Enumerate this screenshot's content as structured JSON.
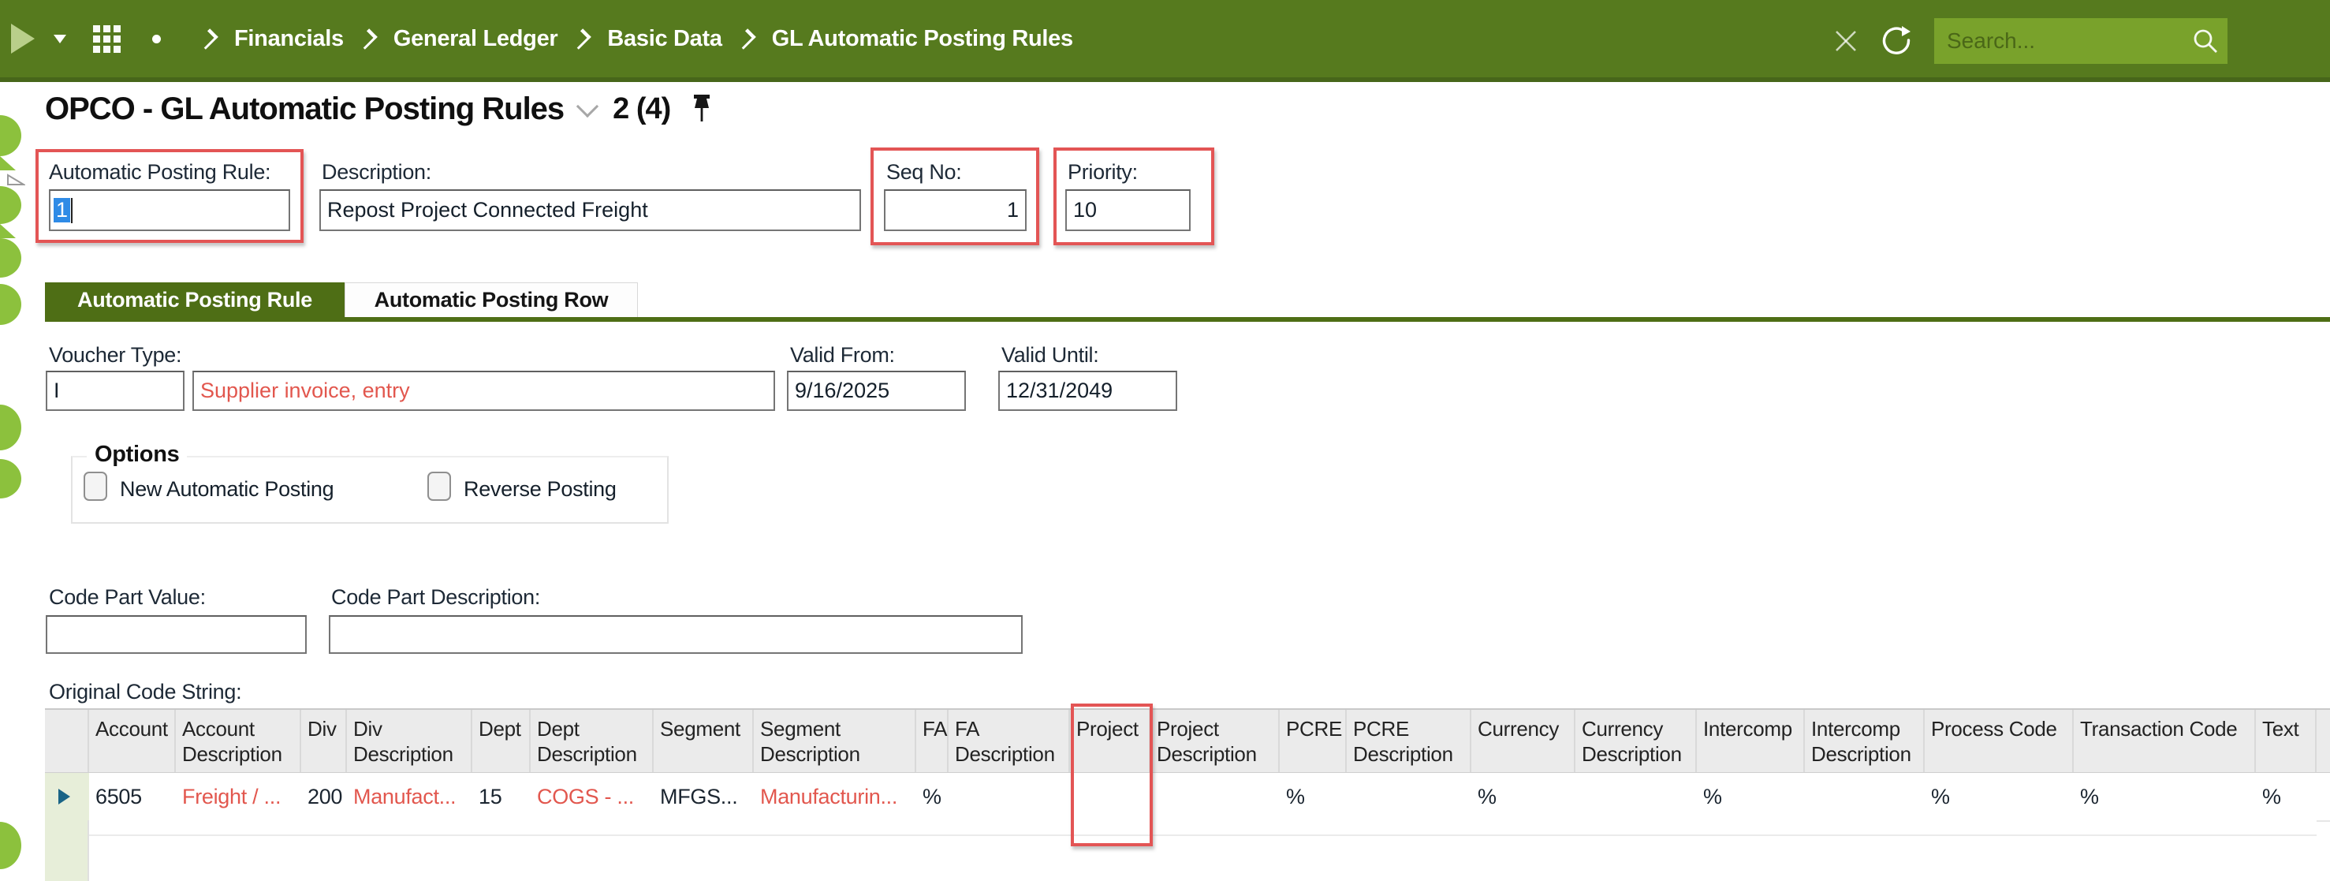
{
  "colors": {
    "topbar_green": "#567a1e",
    "accent_green": "#4e6e15",
    "search_green": "#79a22b",
    "lime_circle": "#8cc13d",
    "annotation_red": "#e35555",
    "field_red_text": "#e2574e",
    "selection_blue": "#2f8be6",
    "row_selector_green": "#e7eed9",
    "row_marker_blue": "#1a6486"
  },
  "topbar": {
    "breadcrumbs": [
      "Financials",
      "General Ledger",
      "Basic Data",
      "GL Automatic Posting Rules"
    ],
    "search": {
      "placeholder": "Search..."
    },
    "icons": {
      "play": "triangle-right",
      "caret": "triangle-down",
      "waffle": "app-grid",
      "dot": "bullet",
      "close": "x-cross",
      "refresh": "circular-arrow",
      "magnifier": "search"
    }
  },
  "page_header": {
    "title": "OPCO - GL Automatic Posting Rules",
    "record_position": "2 (4)",
    "icons": {
      "chevron": "chevron-down",
      "pin": "pushpin"
    }
  },
  "header_fields": {
    "automatic_posting_rule": {
      "label": "Automatic Posting Rule:",
      "value": "1"
    },
    "description": {
      "label": "Description:",
      "value": "Repost Project Connected Freight"
    },
    "seq_no": {
      "label": "Seq No:",
      "value": "1"
    },
    "priority": {
      "label": "Priority:",
      "value": "10"
    }
  },
  "tabs": [
    {
      "label": "Automatic Posting Rule",
      "active": true
    },
    {
      "label": "Automatic Posting Row",
      "active": false
    }
  ],
  "rule_form": {
    "voucher_type": {
      "label": "Voucher Type:",
      "code": "I",
      "description": "Supplier invoice, entry"
    },
    "valid_from": {
      "label": "Valid From:",
      "value": "9/16/2025"
    },
    "valid_until": {
      "label": "Valid Until:",
      "value": "12/31/2049"
    },
    "options": {
      "legend": "Options",
      "checkboxes": [
        {
          "label": "New Automatic Posting",
          "checked": false
        },
        {
          "label": "Reverse Posting",
          "checked": false
        }
      ]
    },
    "code_part_value": {
      "label": "Code Part Value:",
      "value": ""
    },
    "code_part_description": {
      "label": "Code Part Description:",
      "value": ""
    }
  },
  "grid": {
    "caption": "Original Code String:",
    "columns": [
      "Account",
      "Account Description",
      "Div",
      "Div Description",
      "Dept",
      "Dept Description",
      "Segment",
      "Segment Description",
      "FA",
      "FA Description",
      "Project",
      "Project Description",
      "PCRE",
      "PCRE Description",
      "Currency",
      "Currency Description",
      "Intercomp",
      "Intercomp Description",
      "Process Code",
      "Transaction Code",
      "Text"
    ],
    "rows": [
      {
        "cells": [
          "6505",
          "Freight / ...",
          "200",
          "Manufact...",
          "15",
          "COGS - ...",
          "MFGS...",
          "Manufacturin...",
          "%",
          "",
          "",
          "",
          "%",
          "",
          "%",
          "",
          "%",
          "",
          "%",
          "%",
          "%"
        ]
      }
    ]
  }
}
